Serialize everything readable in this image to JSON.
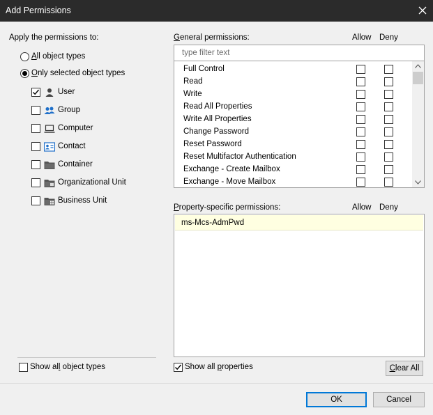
{
  "window": {
    "title": "Add Permissions"
  },
  "apply": {
    "heading": "Apply the permissions to:",
    "options": [
      {
        "label": "All object types",
        "selected": false
      },
      {
        "label": "Only selected object types",
        "selected": true
      }
    ],
    "object_types": [
      {
        "label": "User",
        "checked": true,
        "icon": "user-icon"
      },
      {
        "label": "Group",
        "checked": false,
        "icon": "group-icon"
      },
      {
        "label": "Computer",
        "checked": false,
        "icon": "computer-icon"
      },
      {
        "label": "Contact",
        "checked": false,
        "icon": "contact-icon"
      },
      {
        "label": "Container",
        "checked": false,
        "icon": "folder-icon"
      },
      {
        "label": "Organizational Unit",
        "checked": false,
        "icon": "ou-folder-icon"
      },
      {
        "label": "Business Unit",
        "checked": false,
        "icon": "business-unit-icon"
      }
    ],
    "show_all_label": "Show all object types",
    "show_all_checked": false
  },
  "general": {
    "heading": "General permissions:",
    "allow_header": "Allow",
    "deny_header": "Deny",
    "filter_placeholder": "type filter text",
    "rows": [
      {
        "name": "Full Control",
        "allow": false,
        "deny": false
      },
      {
        "name": "Read",
        "allow": false,
        "deny": false
      },
      {
        "name": "Write",
        "allow": false,
        "deny": false
      },
      {
        "name": "Read All Properties",
        "allow": false,
        "deny": false
      },
      {
        "name": "Write All Properties",
        "allow": false,
        "deny": false
      },
      {
        "name": "Change Password",
        "allow": false,
        "deny": false
      },
      {
        "name": "Reset Password",
        "allow": false,
        "deny": false
      },
      {
        "name": "Reset Multifactor Authentication",
        "allow": false,
        "deny": false
      },
      {
        "name": "Exchange - Create Mailbox",
        "allow": false,
        "deny": false
      },
      {
        "name": "Exchange - Move Mailbox",
        "allow": false,
        "deny": false
      }
    ]
  },
  "property": {
    "heading": "Property-specific permissions:",
    "allow_header": "Allow",
    "deny_header": "Deny",
    "rows": [
      {
        "name": "ms-Mcs-AdmPwd"
      }
    ],
    "show_all_label": "Show all properties",
    "show_all_checked": true,
    "clear_all_label": "Clear All"
  },
  "footer": {
    "ok_label": "OK",
    "cancel_label": "Cancel"
  },
  "colors": {
    "titlebar": "#2b2b2b",
    "accent": "#0078d7",
    "selected_row": "#ffffe1"
  }
}
